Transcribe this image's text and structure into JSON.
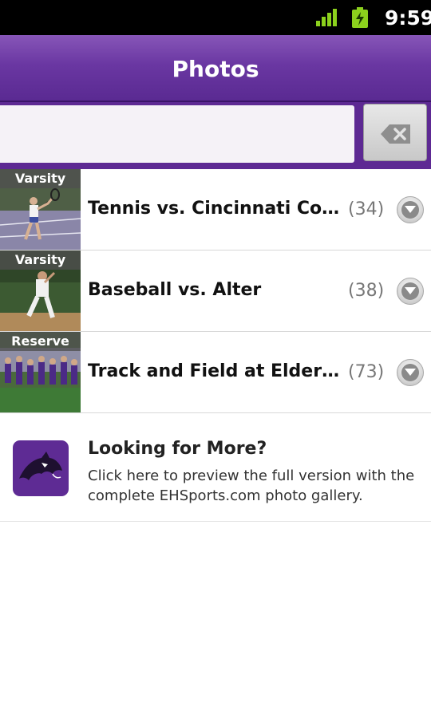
{
  "status_bar": {
    "time": "9:59",
    "signal_icon": "signal-icon",
    "battery_icon": "battery-charging-icon"
  },
  "header": {
    "title": "Photos"
  },
  "search": {
    "value": "",
    "placeholder": "",
    "clear_icon": "backspace-clear-icon"
  },
  "albums": [
    {
      "badge": "Varsity",
      "title": "Tennis vs. Cincinnati Country Day",
      "count": "(34)"
    },
    {
      "badge": "Varsity",
      "title": "Baseball vs. Alter",
      "count": "(38)"
    },
    {
      "badge": "Reserve",
      "title": "Track and Field at Elder Invitational",
      "count": "(73)"
    }
  ],
  "promo": {
    "title": "Looking for More?",
    "text": "Click here to preview the full version with the complete EHSports.com photo gallery.",
    "logo_icon": "panther-logo-icon"
  },
  "colors": {
    "accent": "#6a37a2",
    "header_dark": "#5d2993"
  }
}
